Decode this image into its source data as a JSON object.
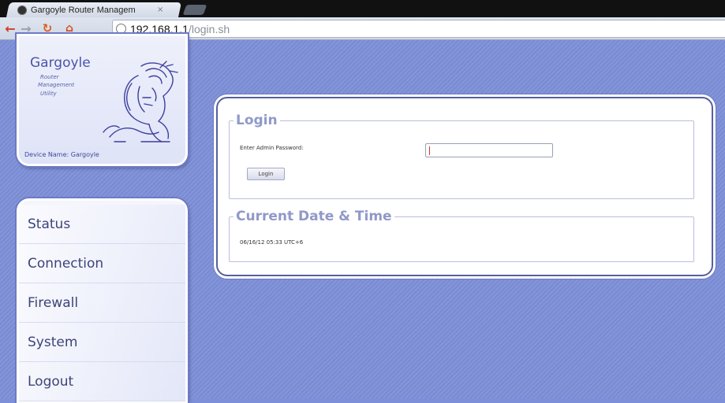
{
  "browser": {
    "tab_title": "Gargoyle Router Managem",
    "tab_close": "×",
    "url_host": "192.168.1.1",
    "url_path": "/login.sh"
  },
  "logo": {
    "title": "Gargoyle",
    "sub_lines": [
      "Router",
      "Management",
      "Utility"
    ],
    "device_name": "Device Name: Gargoyle"
  },
  "menu": {
    "items": [
      "Status",
      "Connection",
      "Firewall",
      "System",
      "Logout"
    ]
  },
  "login": {
    "legend": "Login",
    "password_label": "Enter Admin Password:",
    "password_value": "",
    "button_label": "Login"
  },
  "time": {
    "legend": "Current Date & Time",
    "value": "06/16/12 05:33 UTC+6"
  },
  "colors": {
    "page_bg": "#7d8fd8",
    "legend_text": "#9099c8",
    "panel_border": "#56609e"
  }
}
